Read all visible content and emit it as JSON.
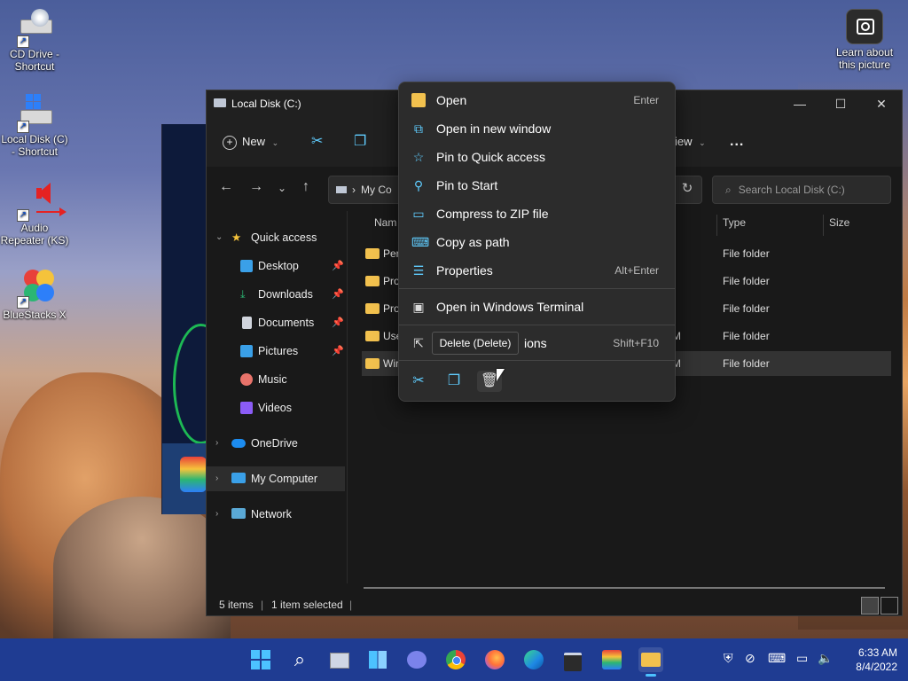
{
  "desktop": {
    "icons": [
      {
        "label_line1": "CD Drive -",
        "label_line2": "Shortcut"
      },
      {
        "label_line1": "Local Disk (C)",
        "label_line2": "- Shortcut"
      },
      {
        "label_line1": "Audio",
        "label_line2": "Repeater (KS)"
      },
      {
        "label_line1": "BlueStacks X",
        "label_line2": ""
      }
    ],
    "learn": {
      "line1": "Learn about",
      "line2": "this picture"
    }
  },
  "explorer": {
    "title": "Local Disk (C:)",
    "toolbar": {
      "new_label": "New",
      "view_label": "iew",
      "more": "..."
    },
    "address": {
      "path": "My Co",
      "chevron": "›"
    },
    "search": {
      "placeholder": "Search Local Disk (C:)"
    },
    "nav": {
      "quick_access": "Quick access",
      "items": [
        "Desktop",
        "Downloads",
        "Documents",
        "Pictures",
        "Music",
        "Videos"
      ],
      "onedrive": "OneDrive",
      "mycomputer": "My Computer",
      "network": "Network"
    },
    "columns": {
      "name": "Nam",
      "type": "Type",
      "size": "Size"
    },
    "rows": [
      {
        "name": "Per",
        "date": "",
        "type": "File folder"
      },
      {
        "name": "Pro",
        "date": "",
        "type": "File folder"
      },
      {
        "name": "Pro",
        "date": "",
        "type": "File folder"
      },
      {
        "name": "Use",
        "date": "M",
        "type": "File folder"
      },
      {
        "name": "Wir",
        "date": "M",
        "type": "File folder"
      }
    ],
    "status": {
      "items": "5 items",
      "selected": "1 item selected"
    }
  },
  "context_menu": {
    "items": [
      {
        "label": "Open",
        "key": "Enter",
        "icon": "folder-open-icon"
      },
      {
        "label": "Open in new window",
        "key": "",
        "icon": "new-window-icon"
      },
      {
        "label": "Pin to Quick access",
        "key": "",
        "icon": "star-icon"
      },
      {
        "label": "Pin to Start",
        "key": "",
        "icon": "pin-icon"
      },
      {
        "label": "Compress to ZIP file",
        "key": "",
        "icon": "zip-icon"
      },
      {
        "label": "Copy as path",
        "key": "",
        "icon": "copy-path-icon"
      },
      {
        "label": "Properties",
        "key": "Alt+Enter",
        "icon": "properties-icon"
      },
      {
        "label": "Open in Windows Terminal",
        "key": "",
        "icon": "terminal-icon"
      },
      {
        "label": "ions",
        "key": "Shift+F10",
        "icon": "more-options-icon"
      }
    ],
    "tooltip": "Delete (Delete)"
  },
  "taskbar": {
    "time": "6:33 AM",
    "date": "8/4/2022"
  },
  "colors": {
    "accent": "#60cdff",
    "taskbar": "#1f3c92",
    "folder": "#f2c14e"
  }
}
